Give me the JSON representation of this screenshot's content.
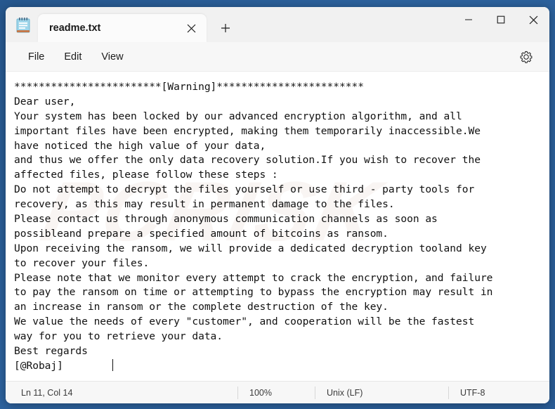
{
  "window": {
    "app_icon": "notepad-icon",
    "caption": {
      "minimize": "minimize-icon",
      "maximize": "maximize-icon",
      "close": "close-icon"
    }
  },
  "tabs": [
    {
      "title": "readme.txt",
      "close_icon": "close-icon",
      "active": true
    }
  ],
  "new_tab": {
    "icon": "plus-icon",
    "label": "+"
  },
  "menubar": {
    "items": [
      {
        "label": "File"
      },
      {
        "label": "Edit"
      },
      {
        "label": "View"
      }
    ],
    "settings_icon": "gear-icon"
  },
  "editor": {
    "watermark": "PCRISK",
    "lines": [
      "************************[Warning]************************",
      "Dear user,",
      "Your system has been locked by our advanced encryption algorithm, and all",
      "important files have been encrypted, making them temporarily inaccessible.We",
      "have noticed the high value of your data,",
      "and thus we offer the only data recovery solution.If you wish to recover the",
      "affected files, please follow these steps :",
      "Do not attempt to decrypt the files yourself or use third - party tools for",
      "recovery, as this may result in permanent damage to the files.",
      "Please contact us through anonymous communication channels as soon as",
      "possibleand prepare a specified amount of bitcoins as ransom.",
      "Upon receiving the ransom, we will provide a dedicated decryption tooland key",
      "to recover your files.",
      "Please note that we monitor every attempt to crack the encryption, and failure",
      "to pay the ransom on time or attempting to bypass the encryption may result in",
      "an increase in ransom or the complete destruction of the key.",
      "We value the needs of every \"customer\", and cooperation will be the fastest",
      "way for you to retrieve your data.",
      "Best regards",
      "[@Robaj]"
    ],
    "caret_line_text": "[@Robaj]        "
  },
  "statusbar": {
    "position": "Ln 11, Col 14",
    "zoom": "100%",
    "line_ending": "Unix (LF)",
    "encoding": "UTF-8"
  },
  "colors": {
    "desktop": "#2c5d9b",
    "window_bg": "#f7f7f7",
    "editor_bg": "#ffffff",
    "text": "#111111"
  }
}
